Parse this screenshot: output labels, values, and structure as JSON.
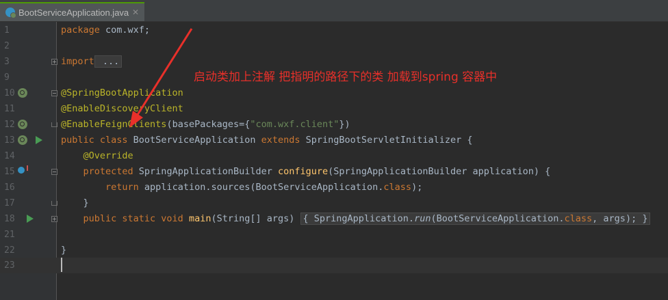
{
  "tab": {
    "title": "BootServiceApplication.java",
    "close": "✕"
  },
  "annotation": "启动类加上注解  把指明的路径下的类 加载到spring 容器中",
  "lines": {
    "l1": {
      "num": "1",
      "a": "package",
      "b": " com.wxf;"
    },
    "l2": {
      "num": "2"
    },
    "l3": {
      "num": "3",
      "a": "import",
      "b": " ..."
    },
    "l9": {
      "num": "9"
    },
    "l10": {
      "num": "10",
      "a": "@SpringBootApplication"
    },
    "l11": {
      "num": "11",
      "a": "@EnableDiscoveryClient"
    },
    "l12": {
      "num": "12",
      "a": "@EnableFeignClients",
      "b": "(basePackages={",
      "c": "\"com.wxf.client\"",
      "d": "})"
    },
    "l13": {
      "num": "13",
      "a": "public class",
      "b": " BootServiceApplication ",
      "c": "extends",
      "d": " SpringBootServletInitializer {"
    },
    "l14": {
      "num": "14",
      "a": "    @Override"
    },
    "l15": {
      "num": "15",
      "a": "    protected",
      "b": " SpringApplicationBuilder ",
      "c": "configure",
      "d": "(SpringApplicationBuilder application) {"
    },
    "l16": {
      "num": "16",
      "a": "        return",
      "b": " application.sources(BootServiceApplication.",
      "c": "class",
      "d": ");"
    },
    "l17": {
      "num": "17",
      "a": "    }"
    },
    "l18": {
      "num": "18",
      "a": "    public static void",
      "b": " main",
      "c": "(String[] args) ",
      "d": "{ SpringApplication.",
      "e": "run",
      "f": "(BootServiceApplication.",
      "g": "class",
      "h": ", args); }"
    },
    "l21": {
      "num": "21"
    },
    "l22": {
      "num": "22",
      "a": "}"
    },
    "l23": {
      "num": "23"
    }
  },
  "colors": {
    "keyword": "#cc7832",
    "annotation": "#bbb529",
    "string": "#6a8759",
    "method": "#ffc66d",
    "text": "#a9b7c6",
    "callout": "#e8302a"
  }
}
